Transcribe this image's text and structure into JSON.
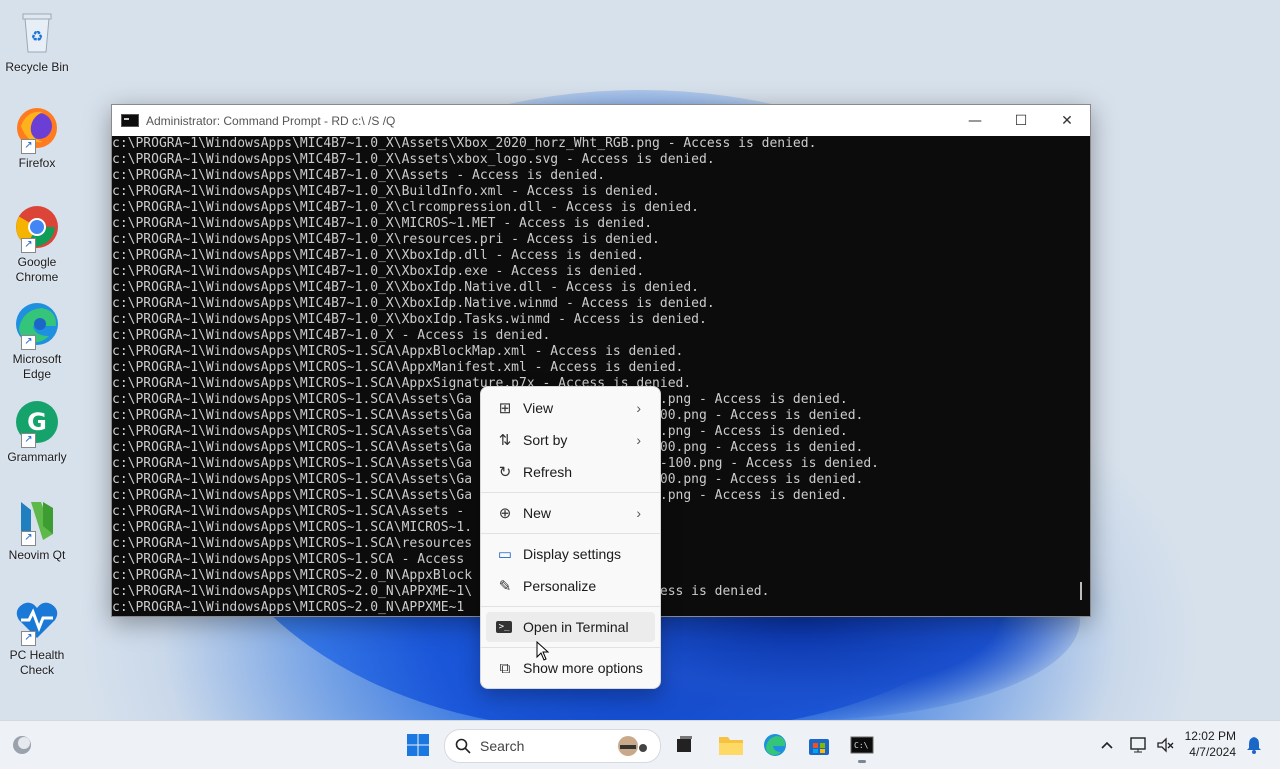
{
  "desktop": {
    "icons": [
      {
        "label": "Recycle Bin"
      },
      {
        "label": "Firefox"
      },
      {
        "label": "Google Chrome"
      },
      {
        "label": "Microsoft Edge"
      },
      {
        "label": "Grammarly"
      },
      {
        "label": "Neovim Qt"
      },
      {
        "label": "PC Health Check"
      }
    ]
  },
  "window": {
    "title": "Administrator: Command Prompt - RD  c:\\ /S /Q",
    "minimize": "—",
    "maximize": "☐",
    "close": "✕",
    "lines": [
      "c:\\PROGRA~1\\WindowsApps\\MIC4B7~1.0_X\\Assets\\Xbox_2020_horz_Wht_RGB.png - Access is denied.",
      "c:\\PROGRA~1\\WindowsApps\\MIC4B7~1.0_X\\Assets\\xbox_logo.svg - Access is denied.",
      "c:\\PROGRA~1\\WindowsApps\\MIC4B7~1.0_X\\Assets - Access is denied.",
      "c:\\PROGRA~1\\WindowsApps\\MIC4B7~1.0_X\\BuildInfo.xml - Access is denied.",
      "c:\\PROGRA~1\\WindowsApps\\MIC4B7~1.0_X\\clrcompression.dll - Access is denied.",
      "c:\\PROGRA~1\\WindowsApps\\MIC4B7~1.0_X\\MICROS~1.MET - Access is denied.",
      "c:\\PROGRA~1\\WindowsApps\\MIC4B7~1.0_X\\resources.pri - Access is denied.",
      "c:\\PROGRA~1\\WindowsApps\\MIC4B7~1.0_X\\XboxIdp.dll - Access is denied.",
      "c:\\PROGRA~1\\WindowsApps\\MIC4B7~1.0_X\\XboxIdp.exe - Access is denied.",
      "c:\\PROGRA~1\\WindowsApps\\MIC4B7~1.0_X\\XboxIdp.Native.dll - Access is denied.",
      "c:\\PROGRA~1\\WindowsApps\\MIC4B7~1.0_X\\XboxIdp.Native.winmd - Access is denied.",
      "c:\\PROGRA~1\\WindowsApps\\MIC4B7~1.0_X\\XboxIdp.Tasks.winmd - Access is denied.",
      "c:\\PROGRA~1\\WindowsApps\\MIC4B7~1.0_X - Access is denied.",
      "c:\\PROGRA~1\\WindowsApps\\MICROS~1.SCA\\AppxBlockMap.xml - Access is denied.",
      "c:\\PROGRA~1\\WindowsApps\\MICROS~1.SCA\\AppxManifest.xml - Access is denied.",
      "c:\\PROGRA~1\\WindowsApps\\MICROS~1.SCA\\AppxSignature.p7x - Access is denied.",
      "c:\\PROGRA~1\\WindowsApps\\MICROS~1.SCA\\Assets\\Ga                   e-100.png - Access is denied.",
      "c:\\PROGRA~1\\WindowsApps\\MICROS~1.SCA\\Assets\\Ga                   ale-100.png - Access is denied.",
      "c:\\PROGRA~1\\WindowsApps\\MICROS~1.SCA\\Assets\\Ga                   e-100.png - Access is denied.",
      "c:\\PROGRA~1\\WindowsApps\\MICROS~1.SCA\\Assets\\Ga                   ale-100.png - Access is denied.",
      "c:\\PROGRA~1\\WindowsApps\\MICROS~1.SCA\\Assets\\Ga                   scale-100.png - Access is denied.",
      "c:\\PROGRA~1\\WindowsApps\\MICROS~1.SCA\\Assets\\Ga                   ale-100.png - Access is denied.",
      "c:\\PROGRA~1\\WindowsApps\\MICROS~1.SCA\\Assets\\Ga                   e-100.png - Access is denied.",
      "c:\\PROGRA~1\\WindowsApps\\MICROS~1.SCA\\Assets -",
      "c:\\PROGRA~1\\WindowsApps\\MICROS~1.SCA\\MICROS~1.",
      "c:\\PROGRA~1\\WindowsApps\\MICROS~1.SCA\\resources                   d.",
      "c:\\PROGRA~1\\WindowsApps\\MICROS~1.SCA - Access",
      "c:\\PROGRA~1\\WindowsApps\\MICROS~2.0_N\\AppxBlock                   ied.",
      "c:\\PROGRA~1\\WindowsApps\\MICROS~2.0_N\\APPXME~1\\                   - Access is denied.",
      "c:\\PROGRA~1\\WindowsApps\\MICROS~2.0_N\\APPXME~1"
    ]
  },
  "context_menu": {
    "items": [
      {
        "label": "View",
        "icon": "grid-icon",
        "glyph": "⊞",
        "submenu": "›"
      },
      {
        "label": "Sort by",
        "icon": "sort-icon",
        "glyph": "⇅",
        "submenu": "›"
      },
      {
        "label": "Refresh",
        "icon": "refresh-icon",
        "glyph": "↻"
      },
      {
        "label": "New",
        "icon": "plus-circle-icon",
        "glyph": "⊕",
        "submenu": "›"
      },
      {
        "label": "Display settings",
        "icon": "display-icon",
        "glyph": "▭"
      },
      {
        "label": "Personalize",
        "icon": "brush-icon",
        "glyph": "✎"
      },
      {
        "label": "Open in Terminal",
        "icon": "terminal-icon",
        "glyph": ">_"
      },
      {
        "label": "Show more options",
        "icon": "more-options-icon",
        "glyph": "⧉"
      }
    ]
  },
  "taskbar": {
    "search_label": "Search",
    "time": "12:02 PM",
    "date": "4/7/2024"
  },
  "colors": {
    "terminal_bg": "#0c0c0c",
    "terminal_fg": "#cccccc",
    "menu_bg": "#f9f9f9",
    "accent": "#0067c0"
  }
}
